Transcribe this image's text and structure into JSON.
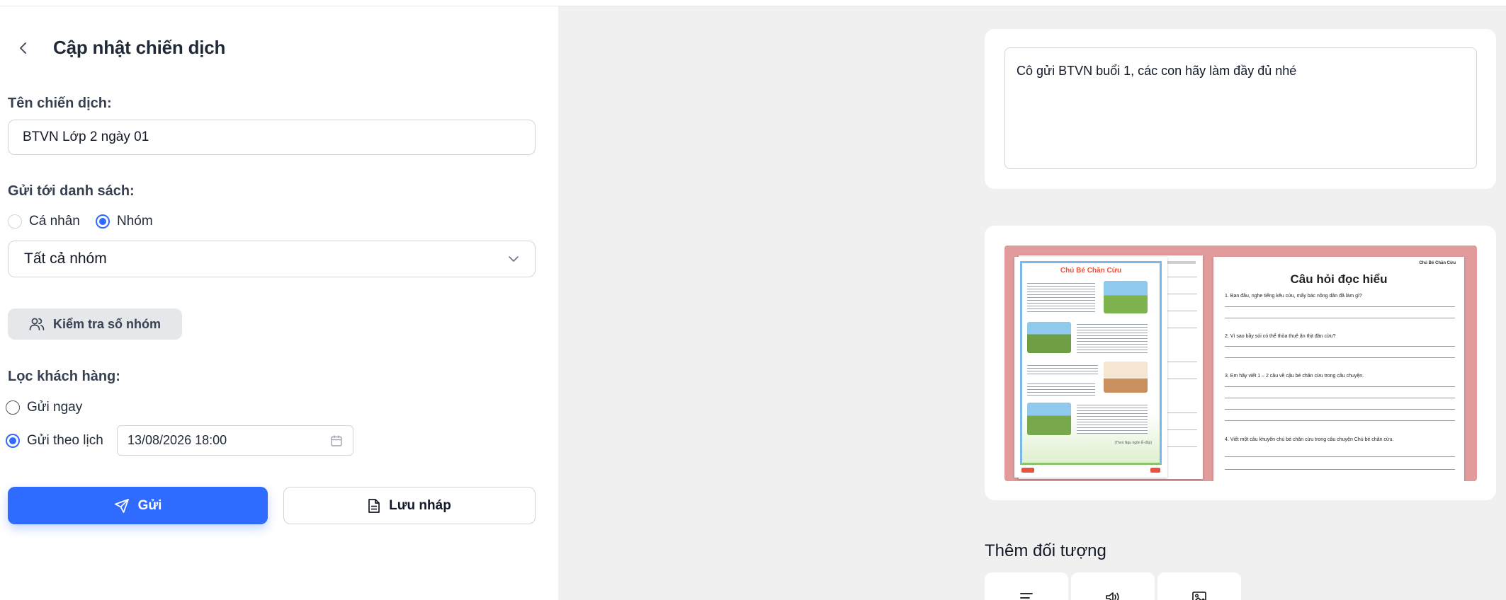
{
  "header": {
    "title": "Cập nhật chiến dịch"
  },
  "form": {
    "campaign_name_label": "Tên chiến dịch:",
    "campaign_name_value": "BTVN Lớp 2 ngày 01",
    "send_to_label": "Gửi tới danh sách:",
    "recipient_options": [
      "Cá nhân",
      "Nhóm"
    ],
    "recipient_selected": "Nhóm",
    "group_select_value": "Tất cả nhóm",
    "check_groups_button": "Kiểm tra số nhóm",
    "filter_label": "Lọc khách hàng:",
    "send_now_label": "Gửi ngay",
    "send_schedule_label": "Gửi theo lịch",
    "schedule_selected": "Gửi theo lịch",
    "schedule_datetime": "13/08/2026 18:00",
    "send_button": "Gửi",
    "save_draft_button": "Lưu nháp"
  },
  "message": {
    "text": "Cô gửi BTVN buổi 1, các con hãy làm đầy đủ nhé"
  },
  "attachment": {
    "worksheet_left_title": "Chú Bé Chăn Cừu",
    "worksheet_left_caption": "(Theo Ngụ ngôn Ê-dốp)",
    "worksheet_right_header": "Chú Bé Chăn Cừu",
    "worksheet_right_title": "Câu hỏi đọc hiểu",
    "questions": [
      "1. Ban đầu, nghe tiếng kêu cứu, mấy bác nông dân đã làm gì?",
      "2. Vì sao bầy sói có thể thỏa thuê ăn thịt đàn cừu?",
      "3. Em hãy viết 1 – 2 câu về cậu bé chăn cừu trong câu chuyện.",
      "4. Viết một câu khuyên chú bé chăn cừu trong câu chuyện Chú bé chăn cừu."
    ]
  },
  "add_objects": {
    "title": "Thêm đối tượng",
    "tiles": [
      {
        "icon": "text-list-icon"
      },
      {
        "icon": "audio-icon"
      },
      {
        "icon": "image-icon"
      }
    ]
  },
  "colors": {
    "primary": "#2f6bff",
    "panel_bg": "#f0f0f0",
    "worksheet_bg": "#e19b9a",
    "worksheet_title": "#e8523f"
  }
}
